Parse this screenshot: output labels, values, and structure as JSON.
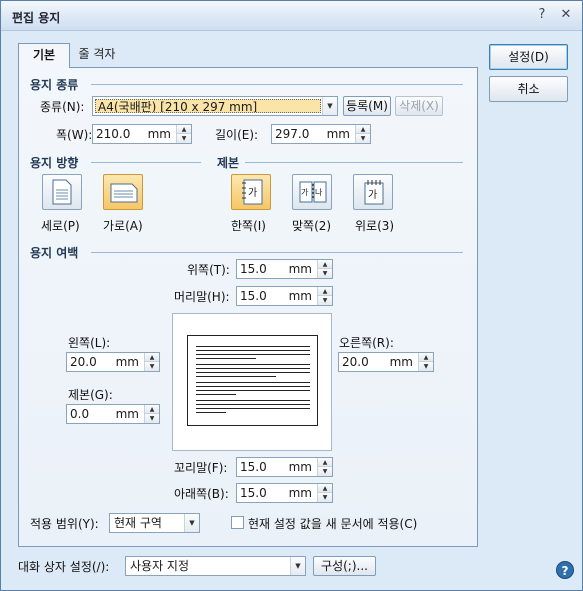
{
  "window": {
    "title": "편집 용지",
    "help_symbol": "?",
    "close_symbol": "✕"
  },
  "tabs": [
    {
      "label": "기본"
    },
    {
      "label": "줄 격자"
    }
  ],
  "buttons": {
    "ok": "설정(D)",
    "cancel": "취소"
  },
  "paper_type": {
    "section": "용지 종류",
    "kind_label": "종류(N):",
    "kind_value": "A4(국배판) [210 x 297 mm]",
    "register": "등록(M)",
    "delete": "삭제(X)",
    "width_label": "폭(W):",
    "width_value": "210.0",
    "length_label": "길이(E):",
    "length_value": "297.0",
    "unit": "mm"
  },
  "orientation": {
    "section": "용지 방향",
    "portrait": "세로(P)",
    "landscape": "가로(A)",
    "selected": "landscape"
  },
  "binding": {
    "section": "제본",
    "single": "한쪽(I)",
    "facing": "맞쪽(2)",
    "top": "위로(3)",
    "selected": "single"
  },
  "margins": {
    "section": "용지 여백",
    "top_label": "위쪽(T):",
    "top_value": "15.0",
    "header_label": "머리말(H):",
    "header_value": "15.0",
    "left_label": "왼쪽(L):",
    "left_value": "20.0",
    "right_label": "오른쪽(R):",
    "right_value": "20.0",
    "gutter_label": "제본(G):",
    "gutter_value": "0.0",
    "footer_label": "꼬리말(F):",
    "footer_value": "15.0",
    "bottom_label": "아래쪽(B):",
    "bottom_value": "15.0",
    "unit": "mm"
  },
  "apply": {
    "scope_label": "적용 범위(Y):",
    "scope_value": "현재 구역",
    "new_doc_label": "현재 설정 값을 새 문서에 적용(C)",
    "new_doc_checked": false
  },
  "footer": {
    "dialog_label": "대화 상자 설정(/):",
    "dialog_value": "사용자 지정",
    "configure": "구성(;)..."
  },
  "colors": {
    "accent": "#2f6fae",
    "selected_fill": "#f7c766",
    "background": "#dce9f6"
  }
}
